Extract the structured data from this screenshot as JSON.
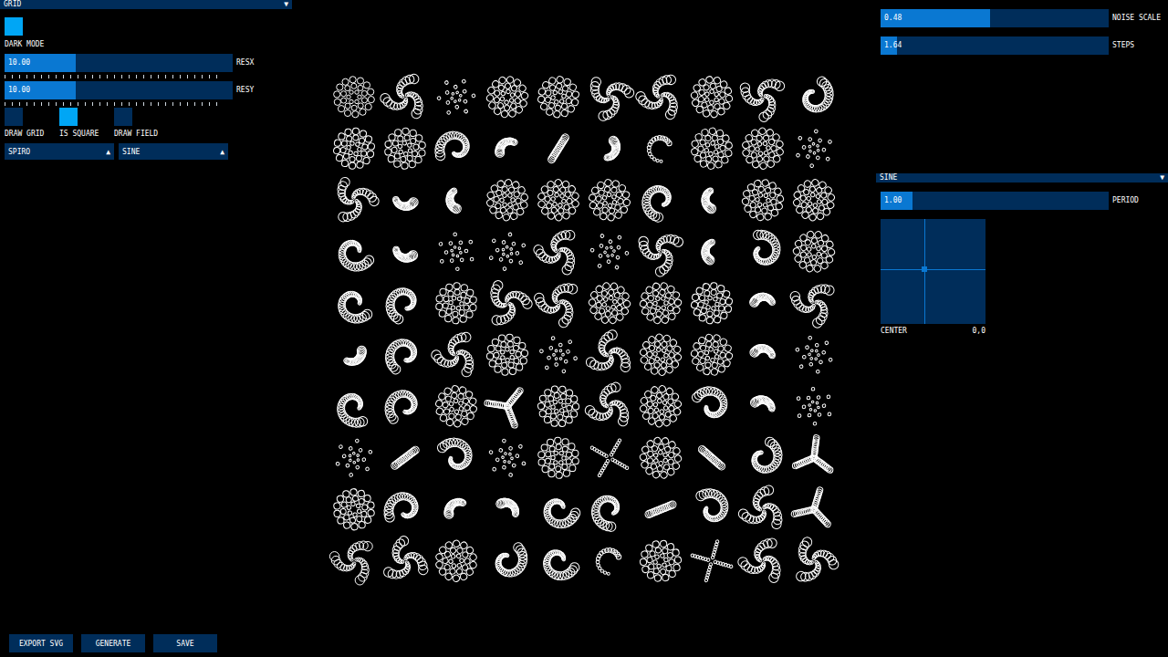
{
  "left_panel": {
    "header": {
      "label": "GRID",
      "arrow": "▼"
    },
    "dark_mode": {
      "label": "DARK MODE",
      "on": true
    },
    "sliders": [
      {
        "label": "RESX",
        "value": "10.00",
        "level": 0.31
      },
      {
        "label": "RESY",
        "value": "10.00",
        "level": 0.31
      }
    ],
    "toggles": [
      {
        "label": "DRAW GRID",
        "on": false
      },
      {
        "label": "IS SQUARE",
        "on": true
      },
      {
        "label": "DRAW FIELD",
        "on": false
      }
    ],
    "dropdowns": [
      {
        "value": "SPIRO",
        "arrow": "▲"
      },
      {
        "value": "SINE",
        "arrow": "▲"
      }
    ]
  },
  "buttons": [
    "EXPORT SVG",
    "GENERATE",
    "SAVE"
  ],
  "right_panel": {
    "sliders": [
      {
        "label": "NOISE SCALE",
        "value": "0.48",
        "level": 0.48
      },
      {
        "label": "STEPS",
        "value": "1.64",
        "level": 0.07
      }
    ],
    "function_dropdown": {
      "label": "SINE",
      "arrow": "▼"
    },
    "period": {
      "label": "PERIOD",
      "value": "1.00",
      "level": 0.14
    },
    "center_pad": {
      "label": "CENTER",
      "value": "0,0",
      "x": 0.42,
      "y": 0.48
    }
  },
  "canvas": {
    "rows": [
      {
        "cells": [
          {
            "kind": "flower"
          },
          {
            "kind": "swirl"
          },
          {
            "kind": "dots"
          },
          {
            "kind": "flower"
          },
          {
            "kind": "flower"
          },
          {
            "kind": "swirl"
          },
          {
            "kind": "swirl"
          },
          {
            "kind": "flower"
          },
          {
            "kind": "swirl"
          },
          {
            "kind": "spiral"
          }
        ]
      },
      {
        "cells": [
          {
            "kind": "flower"
          },
          {
            "kind": "flower"
          },
          {
            "kind": "spiral"
          },
          {
            "kind": "hook"
          },
          {
            "kind": "dash"
          },
          {
            "kind": "hook"
          },
          {
            "kind": "arc"
          },
          {
            "kind": "flower"
          },
          {
            "kind": "flower"
          },
          {
            "kind": "dots"
          }
        ]
      },
      {
        "cells": [
          {
            "kind": "swirl"
          },
          {
            "kind": "hook"
          },
          {
            "kind": "hook"
          },
          {
            "kind": "flower"
          },
          {
            "kind": "flower"
          },
          {
            "kind": "flower"
          },
          {
            "kind": "spiral"
          },
          {
            "kind": "hook"
          },
          {
            "kind": "flower"
          },
          {
            "kind": "flower"
          }
        ]
      },
      {
        "cells": [
          {
            "kind": "spiral"
          },
          {
            "kind": "hook"
          },
          {
            "kind": "dots"
          },
          {
            "kind": "dots"
          },
          {
            "kind": "swirl"
          },
          {
            "kind": "dots"
          },
          {
            "kind": "swirl"
          },
          {
            "kind": "hook"
          },
          {
            "kind": "spiral"
          },
          {
            "kind": "flower"
          }
        ]
      },
      {
        "cells": [
          {
            "kind": "spiral"
          },
          {
            "kind": "spiral"
          },
          {
            "kind": "flower"
          },
          {
            "kind": "swirl"
          },
          {
            "kind": "swirl"
          },
          {
            "kind": "flower"
          },
          {
            "kind": "flower"
          },
          {
            "kind": "flower"
          },
          {
            "kind": "hook"
          },
          {
            "kind": "swirl"
          }
        ]
      },
      {
        "cells": [
          {
            "kind": "hook"
          },
          {
            "kind": "spiral"
          },
          {
            "kind": "swirl"
          },
          {
            "kind": "flower"
          },
          {
            "kind": "dots"
          },
          {
            "kind": "swirl"
          },
          {
            "kind": "flower"
          },
          {
            "kind": "flower"
          },
          {
            "kind": "hook"
          },
          {
            "kind": "dots"
          }
        ]
      },
      {
        "cells": [
          {
            "kind": "spiral"
          },
          {
            "kind": "spiral"
          },
          {
            "kind": "flower"
          },
          {
            "kind": "tri"
          },
          {
            "kind": "flower"
          },
          {
            "kind": "swirl"
          },
          {
            "kind": "flower"
          },
          {
            "kind": "spiral"
          },
          {
            "kind": "hook"
          },
          {
            "kind": "dots"
          }
        ]
      },
      {
        "cells": [
          {
            "kind": "dots"
          },
          {
            "kind": "dash"
          },
          {
            "kind": "spiral"
          },
          {
            "kind": "dots"
          },
          {
            "kind": "flower"
          },
          {
            "kind": "cross"
          },
          {
            "kind": "flower"
          },
          {
            "kind": "dash"
          },
          {
            "kind": "spiral"
          },
          {
            "kind": "tri"
          }
        ]
      },
      {
        "cells": [
          {
            "kind": "flower"
          },
          {
            "kind": "spiral"
          },
          {
            "kind": "hook"
          },
          {
            "kind": "hook"
          },
          {
            "kind": "spiral"
          },
          {
            "kind": "spiral"
          },
          {
            "kind": "dash"
          },
          {
            "kind": "spiral"
          },
          {
            "kind": "swirl"
          },
          {
            "kind": "tri"
          }
        ]
      },
      {
        "cells": [
          {
            "kind": "swirl"
          },
          {
            "kind": "swirl"
          },
          {
            "kind": "flower"
          },
          {
            "kind": "spiral"
          },
          {
            "kind": "spiral"
          },
          {
            "kind": "arc"
          },
          {
            "kind": "flower"
          },
          {
            "kind": "cross"
          },
          {
            "kind": "swirl"
          },
          {
            "kind": "swirl"
          }
        ]
      }
    ]
  }
}
